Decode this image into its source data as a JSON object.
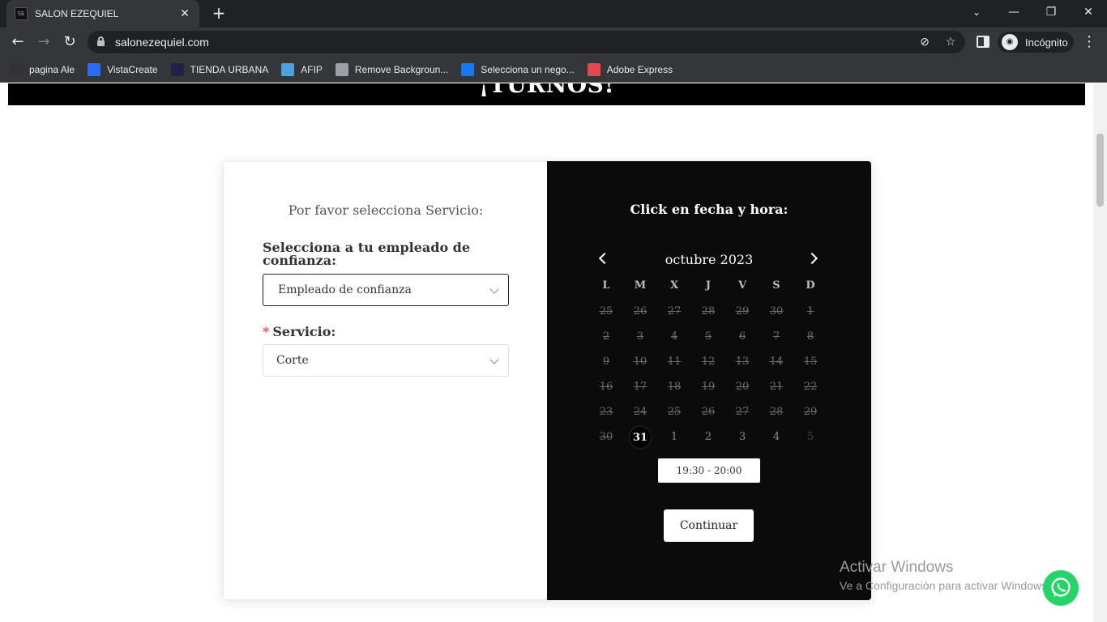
{
  "browser": {
    "tab_title": "SALON EZEQUIEL",
    "tab_close": "✕",
    "new_tab": "+",
    "url": "salonezequiel.com",
    "profile_label": "Incógnito",
    "window_controls": {
      "minimize": "—",
      "restore": "❐",
      "close": "✕"
    },
    "bookmarks": [
      {
        "label": "pagina Ale",
        "icon": "barcode-icon",
        "color": "#333333"
      },
      {
        "label": "VistaCreate",
        "icon": "vistacreate-icon",
        "color": "#2a6cf6"
      },
      {
        "label": "TIENDA URBANA",
        "icon": "store-icon",
        "color": "#222244"
      },
      {
        "label": "AFIP",
        "icon": "afip-icon",
        "color": "#4aa3df"
      },
      {
        "label": "Remove Backgroun...",
        "icon": "layers-icon",
        "color": "#9aa0a6"
      },
      {
        "label": "Selecciona un nego...",
        "icon": "meta-icon",
        "color": "#1877f2"
      },
      {
        "label": "Adobe Express",
        "icon": "adobe-express-icon",
        "color": "#e34850"
      }
    ]
  },
  "banner": {
    "title": "¡TURNOS!"
  },
  "form": {
    "heading": "Por favor selecciona Servicio:",
    "employee_label": "Selecciona a tu empleado de confianza:",
    "employee_value": "Empleado de confianza",
    "service_required_mark": "*",
    "service_label": "Servicio:",
    "service_value": "Corte"
  },
  "calendar": {
    "heading": "Click en fecha y hora:",
    "month": "octubre 2023",
    "weekdays": [
      "L",
      "M",
      "X",
      "J",
      "V",
      "S",
      "D"
    ],
    "weeks": [
      [
        "25",
        "26",
        "27",
        "28",
        "29",
        "30",
        "1"
      ],
      [
        "2",
        "3",
        "4",
        "5",
        "6",
        "7",
        "8"
      ],
      [
        "9",
        "10",
        "11",
        "12",
        "13",
        "14",
        "15"
      ],
      [
        "16",
        "17",
        "18",
        "19",
        "20",
        "21",
        "22"
      ],
      [
        "23",
        "24",
        "25",
        "26",
        "27",
        "28",
        "29"
      ],
      [
        "30",
        "31",
        "1",
        "2",
        "3",
        "4",
        "5"
      ]
    ],
    "selected_day": "31",
    "time_slot": "19:30 - 20:00",
    "continue_label": "Continuar"
  },
  "watermark": {
    "line1": "Activar Windows",
    "line2": "Ve a Configuración para activar Windows."
  }
}
